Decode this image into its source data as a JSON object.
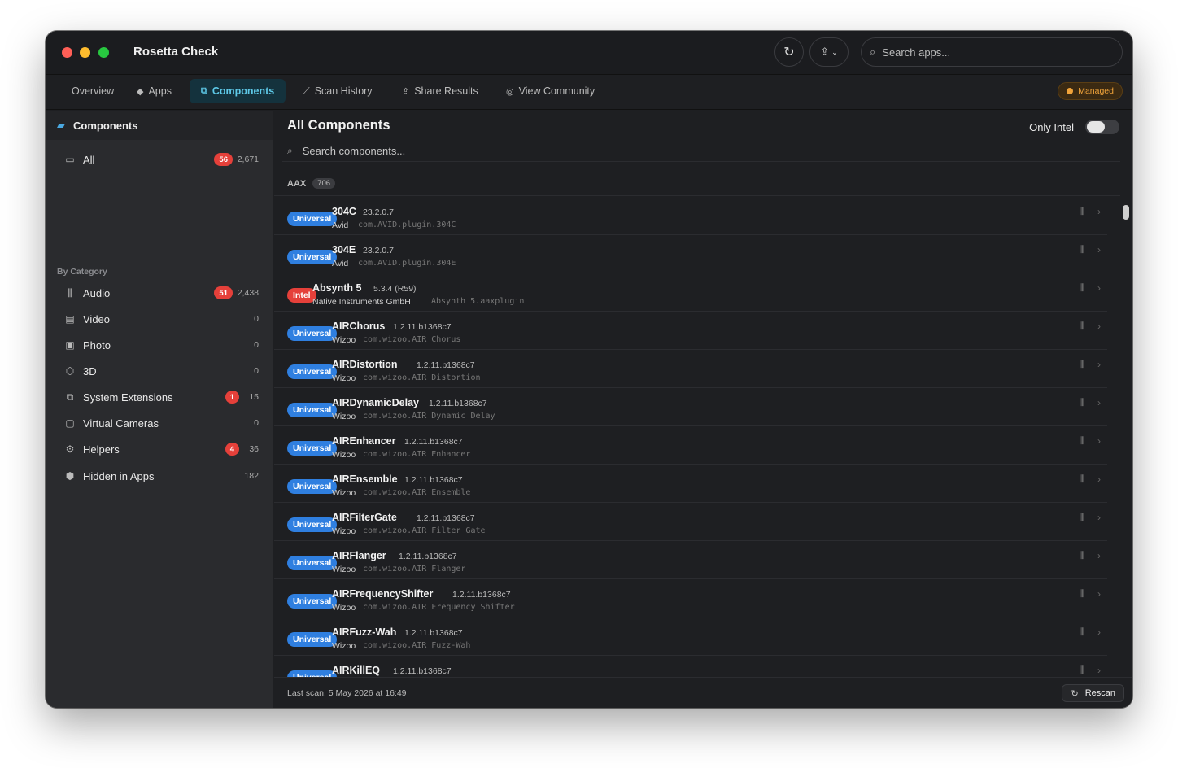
{
  "window": {
    "title": "Rosetta Check"
  },
  "toolbar": {
    "refresh_icon": "refresh-icon",
    "share_icon": "share-icon",
    "search_placeholder": "Search apps..."
  },
  "tabs": [
    {
      "label": "Overview",
      "icon": "",
      "active": false
    },
    {
      "label": "Apps",
      "icon": "apps-icon",
      "active": false
    },
    {
      "label": "Components",
      "icon": "components-icon",
      "active": true
    },
    {
      "label": "Scan History",
      "icon": "chart-icon",
      "active": false
    },
    {
      "label": "Share Results",
      "icon": "share-icon",
      "active": false
    },
    {
      "label": "View Community",
      "icon": "globe-icon",
      "active": false
    }
  ],
  "managed_label": "Managed",
  "sidebar": {
    "header": "Components",
    "all": {
      "label": "All",
      "badge": "56",
      "count": "2,671"
    },
    "section_label": "By Category",
    "items": [
      {
        "label": "Audio",
        "badge": "51",
        "count": "2,438",
        "icon": "waveform-icon"
      },
      {
        "label": "Video",
        "badge": "",
        "count": "0",
        "icon": "film-icon"
      },
      {
        "label": "Photo",
        "badge": "",
        "count": "0",
        "icon": "photo-icon"
      },
      {
        "label": "3D",
        "badge": "",
        "count": "0",
        "icon": "cube-icon"
      },
      {
        "label": "System Extensions",
        "badge": "1",
        "count": "15",
        "icon": "extension-icon"
      },
      {
        "label": "Virtual Cameras",
        "badge": "",
        "count": "0",
        "icon": "camera-icon"
      },
      {
        "label": "Helpers",
        "badge": "4",
        "count": "36",
        "icon": "gears-icon"
      },
      {
        "label": "Hidden in Apps",
        "badge": "",
        "count": "182",
        "icon": "package-icon"
      }
    ]
  },
  "main": {
    "title": "All Components",
    "only_intel_label": "Only Intel",
    "only_intel_on": false,
    "search_placeholder": "Search components...",
    "group": {
      "name": "AAX",
      "count": "706"
    },
    "rows": [
      {
        "arch": "Universal",
        "name": "304C",
        "version": "23.2.0.7",
        "vendor": "Avid",
        "bundle": "com.AVID.plugin.304C"
      },
      {
        "arch": "Universal",
        "name": "304E",
        "version": "23.2.0.7",
        "vendor": "Avid",
        "bundle": "com.AVID.plugin.304E"
      },
      {
        "arch": "Intel",
        "name": "Absynth 5",
        "version": "5.3.4 (R59)",
        "vendor": "Native Instruments GmbH",
        "bundle": "Absynth 5.aaxplugin"
      },
      {
        "arch": "Universal",
        "name": "AIRChorus",
        "version": "1.2.11.b1368c7",
        "vendor": "Wizoo",
        "bundle": "com.wizoo.AIR Chorus"
      },
      {
        "arch": "Universal",
        "name": "AIRDistortion",
        "version": "1.2.11.b1368c7",
        "vendor": "Wizoo",
        "bundle": "com.wizoo.AIR Distortion"
      },
      {
        "arch": "Universal",
        "name": "AIRDynamicDelay",
        "version": "1.2.11.b1368c7",
        "vendor": "Wizoo",
        "bundle": "com.wizoo.AIR Dynamic Delay"
      },
      {
        "arch": "Universal",
        "name": "AIREnhancer",
        "version": "1.2.11.b1368c7",
        "vendor": "Wizoo",
        "bundle": "com.wizoo.AIR Enhancer"
      },
      {
        "arch": "Universal",
        "name": "AIREnsemble",
        "version": "1.2.11.b1368c7",
        "vendor": "Wizoo",
        "bundle": "com.wizoo.AIR Ensemble"
      },
      {
        "arch": "Universal",
        "name": "AIRFilterGate",
        "version": "1.2.11.b1368c7",
        "vendor": "Wizoo",
        "bundle": "com.wizoo.AIR Filter Gate"
      },
      {
        "arch": "Universal",
        "name": "AIRFlanger",
        "version": "1.2.11.b1368c7",
        "vendor": "Wizoo",
        "bundle": "com.wizoo.AIR Flanger"
      },
      {
        "arch": "Universal",
        "name": "AIRFrequencyShifter",
        "version": "1.2.11.b1368c7",
        "vendor": "Wizoo",
        "bundle": "com.wizoo.AIR Frequency Shifter"
      },
      {
        "arch": "Universal",
        "name": "AIRFuzz-Wah",
        "version": "1.2.11.b1368c7",
        "vendor": "Wizoo",
        "bundle": "com.wizoo.AIR Fuzz-Wah"
      },
      {
        "arch": "Universal",
        "name": "AIRKillEQ",
        "version": "1.2.11.b1368c7",
        "vendor": "",
        "bundle": ""
      }
    ]
  },
  "footer": {
    "last_scan": "Last scan: 5 May 2026 at 16:49",
    "rescan_label": "Rescan"
  },
  "colors": {
    "accent": "#5ec9e8",
    "universal": "#2f7fe0",
    "intel": "#e5403a",
    "managed": "#f0a33a"
  }
}
